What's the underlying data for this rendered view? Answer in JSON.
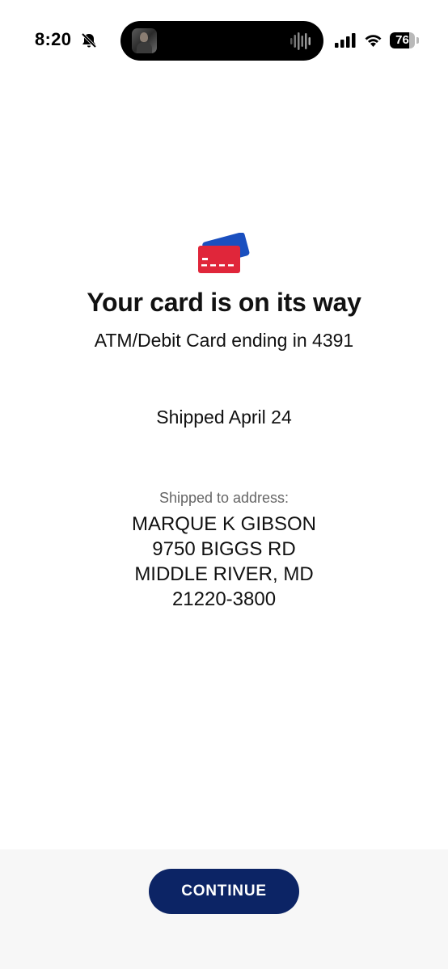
{
  "status_bar": {
    "time": "8:20",
    "battery_level": "76",
    "icons": [
      "bell-slash-icon",
      "now-playing-art",
      "audio-waveform-icon",
      "signal-icon",
      "wifi-icon",
      "battery-icon"
    ]
  },
  "main": {
    "icon": "card-icon",
    "title": "Your card is on its way",
    "subtitle": "ATM/Debit Card ending in 4391",
    "shipped_date": "Shipped April 24",
    "address_label": "Shipped to address:",
    "address": {
      "name": "MARQUE K GIBSON",
      "street": "9750 BIGGS RD",
      "city_state": "MIDDLE RIVER, MD",
      "zip": "21220-3800"
    }
  },
  "footer": {
    "continue_label": "CONTINUE"
  },
  "colors": {
    "brand_navy": "#0c2465",
    "card_red": "#e0263a",
    "card_blue": "#1a4fbf",
    "muted_text": "#666666"
  }
}
